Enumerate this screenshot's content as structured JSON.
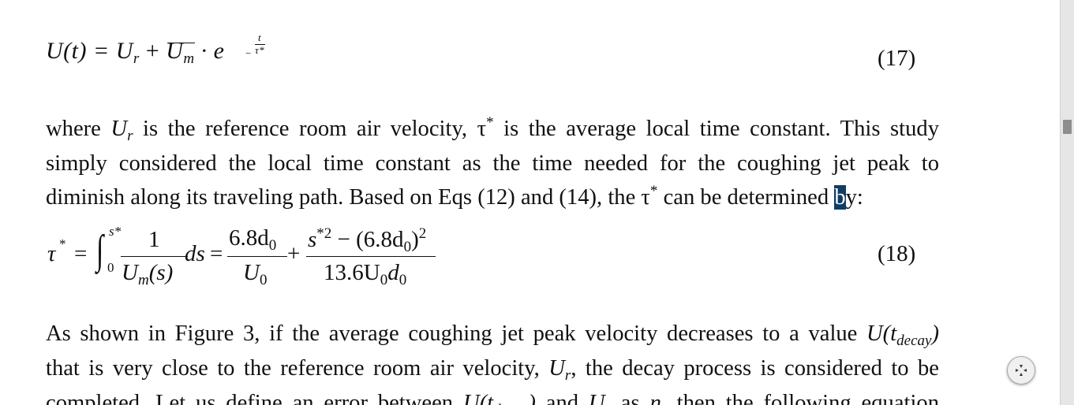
{
  "equation_17": {
    "lhs": "U(t) = U",
    "sub_r": "r",
    "plus": " + ",
    "um_base": "U",
    "sub_m": "m",
    "dot_e": " · e",
    "exp_num": "t",
    "exp_den": "τ*",
    "exp_minus": "−",
    "number": "(17)"
  },
  "paragraph_1": {
    "l1_a": "where ",
    "l1_U": "U",
    "l1_r": "r",
    "l1_b": " is the reference room air velocity, τ",
    "l1_star": "*",
    "l1_c": " is the average local time constant. This study",
    "l2": "simply considered the local time constant as the time needed for the coughing jet peak to",
    "l3_a": "diminish along its traveling path. Based on Eqs (12) and (14), the τ",
    "l3_star": "*",
    "l3_b": " can be determined ",
    "l3_hl": "b",
    "l3_c": "y:"
  },
  "equation_18": {
    "tau": "τ",
    "tau_star": "*",
    "eq1": "=",
    "integral": "∫",
    "int_upper": "s*",
    "int_lower": "0",
    "f1_num": "1",
    "f1_den": "U",
    "f1_den_sub": "m",
    "f1_den_arg": "(s)",
    "ds": "ds",
    "eq2": "=",
    "f2_num": "6.8d",
    "f2_num_sub": "0",
    "f2_den": "U",
    "f2_den_sub": "0",
    "plus": "+",
    "f3_num_a": "s",
    "f3_num_sup": "*2",
    "f3_num_b": " − (6.8d",
    "f3_num_sub": "0",
    "f3_num_c": ")",
    "f3_num_sq": "2",
    "f3_den": "13.6U",
    "f3_den_sub1": "0",
    "f3_den_d": "d",
    "f3_den_sub2": "0",
    "number": "(18)"
  },
  "paragraph_2": {
    "l1_a": "As shown in Figure 3, if the average coughing jet peak velocity decreases to a value ",
    "l1_U": "U(t",
    "l1_sub": "decay",
    "l1_end": ")",
    "l2_a": "that is very close to the reference room air velocity, ",
    "l2_U": "U",
    "l2_r": "r",
    "l2_b": ", the decay process is considered to be",
    "l3_a": "completed. Let us define an error between ",
    "l3_U": "U(t",
    "l3_sub": "decay",
    "l3_end": ")",
    "l3_b": " and ",
    "l3_Ur": "U",
    "l3_r": "r",
    "l3_c": " as ",
    "l3_eta": "η",
    "l3_d": ", then the following equation"
  },
  "icons": {
    "nav": "navigation-arrows-icon"
  }
}
